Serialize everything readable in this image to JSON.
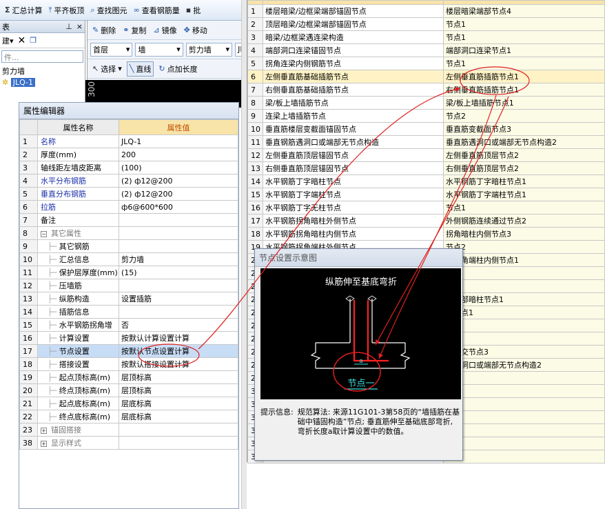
{
  "toolbar": {
    "items": [
      {
        "icon": "sigma-icon",
        "label": "汇总计算"
      },
      {
        "icon": "align-top-icon",
        "label": "平齐板顶"
      },
      {
        "icon": "find-element-icon",
        "label": "查找图元"
      },
      {
        "icon": "view-rebar-icon",
        "label": "查看钢筋量"
      },
      {
        "icon": "more-icon",
        "label": "批"
      }
    ]
  },
  "left_pane": {
    "title": "表",
    "pin": "ㅁ",
    "close": "×",
    "new_label": "建",
    "search_placeholder": "件...",
    "tree_group": "剪力墙",
    "tree_item": "JLQ-1"
  },
  "mid_toolbar": {
    "row1": [
      {
        "icon": "delete-icon",
        "label": "删除"
      },
      {
        "icon": "copy-icon",
        "label": "复制"
      },
      {
        "icon": "mirror-icon",
        "label": "镜像"
      },
      {
        "icon": "move-icon",
        "label": "移动"
      }
    ],
    "floor": "首层",
    "category": "墙",
    "type": "剪力墙",
    "type_more": "JI",
    "row3": [
      {
        "icon": "select-icon",
        "label": "选择"
      },
      {
        "icon": "line-icon",
        "label": "直线"
      },
      {
        "icon": "point-length-icon",
        "label": "点加长度"
      }
    ],
    "ruler": "300"
  },
  "property_editor": {
    "title": "属性编辑器",
    "col_name": "属性名称",
    "col_value": "属性值",
    "rows": [
      {
        "n": "1",
        "name": "名称",
        "value": "JLQ-1",
        "style": "blue",
        "indent": 0
      },
      {
        "n": "2",
        "name": "厚度(mm)",
        "value": "200",
        "style": "",
        "indent": 0
      },
      {
        "n": "3",
        "name": "轴线距左墙皮距离",
        "value": "(100)",
        "style": "",
        "indent": 0
      },
      {
        "n": "4",
        "name": "水平分布钢筋",
        "value": "(2) ф12@200",
        "style": "blue",
        "indent": 0
      },
      {
        "n": "5",
        "name": "垂直分布钢筋",
        "value": "(2) ф12@200",
        "style": "blue",
        "indent": 0
      },
      {
        "n": "6",
        "name": "拉筋",
        "value": "ф6@600*600",
        "style": "blue",
        "indent": 0
      },
      {
        "n": "7",
        "name": "备注",
        "value": "",
        "style": "",
        "indent": 0
      },
      {
        "n": "8",
        "name": "其它属性",
        "value": "",
        "style": "gray",
        "indent": 0,
        "toggle": "−"
      },
      {
        "n": "9",
        "name": "其它钢筋",
        "value": "",
        "style": "",
        "indent": 1
      },
      {
        "n": "10",
        "name": "汇总信息",
        "value": "剪力墙",
        "style": "",
        "indent": 1
      },
      {
        "n": "11",
        "name": "保护层厚度(mm)",
        "value": "(15)",
        "style": "",
        "indent": 1
      },
      {
        "n": "12",
        "name": "压墙筋",
        "value": "",
        "style": "",
        "indent": 1
      },
      {
        "n": "13",
        "name": "纵筋构造",
        "value": "设置插筋",
        "style": "",
        "indent": 1
      },
      {
        "n": "14",
        "name": "插筋信息",
        "value": "",
        "style": "",
        "indent": 1
      },
      {
        "n": "15",
        "name": "水平钢筋拐角增",
        "value": "否",
        "style": "",
        "indent": 1
      },
      {
        "n": "16",
        "name": "计算设置",
        "value": "按默认计算设置计算",
        "style": "",
        "indent": 1
      },
      {
        "n": "17",
        "name": "节点设置",
        "value": "按默认节点设置计算",
        "style": "",
        "indent": 1,
        "selected": true
      },
      {
        "n": "18",
        "name": "搭接设置",
        "value": "按默认搭接设置计算",
        "style": "",
        "indent": 1
      },
      {
        "n": "19",
        "name": "起点顶标高(m)",
        "value": "层顶标高",
        "style": "",
        "indent": 1
      },
      {
        "n": "20",
        "name": "终点顶标高(m)",
        "value": "层顶标高",
        "style": "",
        "indent": 1
      },
      {
        "n": "21",
        "name": "起点底标高(m)",
        "value": "层底标高",
        "style": "",
        "indent": 1
      },
      {
        "n": "22",
        "name": "终点底标高(m)",
        "value": "层底标高",
        "style": "",
        "indent": 1
      },
      {
        "n": "23",
        "name": "锚固搭接",
        "value": "",
        "style": "gray",
        "indent": 0,
        "toggle": "+"
      },
      {
        "n": "38",
        "name": "显示样式",
        "value": "",
        "style": "gray",
        "indent": 0,
        "toggle": "+"
      }
    ]
  },
  "node_grid": {
    "rows": [
      {
        "n": "1",
        "a": "楼层暗梁/边框梁端部锚固节点",
        "v": "楼层暗梁端部节点4"
      },
      {
        "n": "2",
        "a": "顶层暗梁/边框梁端部锚固节点",
        "v": "节点1"
      },
      {
        "n": "3",
        "a": "暗梁/边框梁遇连梁构造",
        "v": "节点1"
      },
      {
        "n": "4",
        "a": "端部洞口连梁锚固节点",
        "v": "端部洞口连梁节点1"
      },
      {
        "n": "5",
        "a": "拐角连梁内侧钢筋节点",
        "v": "节点1"
      },
      {
        "n": "6",
        "a": "左侧垂直筋基础插筋节点",
        "v": "左侧垂直筋插筋节点1",
        "hl": true
      },
      {
        "n": "7",
        "a": "右侧垂直筋基础插筋节点",
        "v": "右侧垂直筋插筋节点1"
      },
      {
        "n": "8",
        "a": "梁/板上墙插筋节点",
        "v": "梁/板上墙插筋节点1"
      },
      {
        "n": "9",
        "a": "连梁上墙插筋节点",
        "v": "节点2"
      },
      {
        "n": "10",
        "a": "垂直筋楼层变截面锚固节点",
        "v": "垂直筋变截面节点3"
      },
      {
        "n": "11",
        "a": "垂直钢筋遇洞口或端部无节点构造",
        "v": "垂直筋遇洞口或端部无节点构造2"
      },
      {
        "n": "12",
        "a": "左侧垂直筋顶层锚固节点",
        "v": "左侧垂直筋顶层节点2"
      },
      {
        "n": "13",
        "a": "右侧垂直筋顶层锚固节点",
        "v": "右侧垂直筋顶层节点2"
      },
      {
        "n": "14",
        "a": "水平钢筋丁字暗柱节点",
        "v": "水平钢筋丁字暗柱节点1"
      },
      {
        "n": "15",
        "a": "水平钢筋丁字端柱节点",
        "v": "水平钢筋丁字端柱节点1"
      },
      {
        "n": "16",
        "a": "水平钢筋丁字无柱节点",
        "v": "节点1"
      },
      {
        "n": "17",
        "a": "水平钢筋拐角暗柱外侧节点",
        "v": "外侧钢筋连续通过节点2"
      },
      {
        "n": "18",
        "a": "水平钢筋拐角暗柱内侧节点",
        "v": "拐角暗柱内侧节点3"
      },
      {
        "n": "19",
        "a": "水平钢筋拐角端柱外侧节点",
        "v": "节点2"
      },
      {
        "n": "20",
        "a": "",
        "v": "筋拐角端柱内侧节点1"
      },
      {
        "n": "21",
        "a": "",
        "v": ""
      },
      {
        "n": "22",
        "a": "",
        "v": ""
      },
      {
        "n": "23",
        "a": "",
        "v": "筋端部暗柱节点1"
      },
      {
        "n": "24",
        "a": "",
        "v": "柱节点1"
      },
      {
        "n": "25",
        "a": "",
        "v": ""
      },
      {
        "n": "26",
        "a": "",
        "v": ""
      },
      {
        "n": "27",
        "a": "",
        "v": "筋斜交节点3"
      },
      {
        "n": "28",
        "a": "",
        "v": "筋遇洞口或端部无节点构造2"
      },
      {
        "n": "29",
        "a": "",
        "v": ""
      },
      {
        "n": "30",
        "a": "",
        "v": ""
      },
      {
        "n": "31",
        "a": "",
        "v": "置"
      },
      {
        "n": "32",
        "a": "",
        "v": ""
      },
      {
        "n": "33",
        "a": "",
        "v": ""
      },
      {
        "n": "34",
        "a": "",
        "v": ""
      },
      {
        "n": "35",
        "a": "",
        "v": "置"
      }
    ]
  },
  "popup": {
    "title": "节点设置示意图",
    "diagram_title": "纵筋伸至基底弯折",
    "dim_label": "a",
    "node_label": "节点一",
    "hint_label": "提示信息:",
    "hint_text": "规范算法: 来源11G101-3第58页的“墙插筋在基础中锚固构造”节点; 垂直筋伸至基础底部弯折, 弯折长度a取计算设置中的数值。"
  },
  "colors": {
    "annotation": "#e02020",
    "diagram_bg": "#000000",
    "diagram_rebar": "#ff2020",
    "diagram_label": "#40e0e0",
    "header_value_bg": "#f8e3a8",
    "selected_row": "#c7dcf5"
  }
}
